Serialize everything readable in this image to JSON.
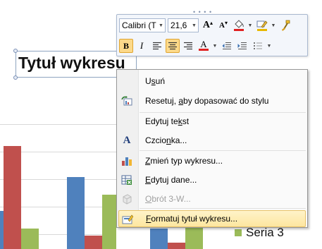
{
  "chart": {
    "title": "Tytuł wykresu",
    "legend": [
      {
        "name": "Seria 3",
        "color": "#9bbb59"
      }
    ],
    "colors": {
      "seria1": "#4f81bd",
      "seria2": "#c0504d",
      "seria3": "#9bbb59"
    }
  },
  "mini_toolbar": {
    "font_name": "Calibri (T",
    "font_size": "21,6",
    "grow_font": "A",
    "shrink_font": "A",
    "bold": "B",
    "italic": "I",
    "font_color_letter": "A",
    "font_color": "#e02020",
    "fill_color": "#e02020",
    "line_color": "#e8b800"
  },
  "context_menu": {
    "items": [
      {
        "pre": "U",
        "ul": "s",
        "post": "uń",
        "icon": "none",
        "enabled": true
      },
      {
        "pre": "Resetuj, ",
        "ul": "a",
        "post": "by dopasować do stylu",
        "icon": "reset-style-icon",
        "enabled": true
      },
      {
        "pre": "Edytuj te",
        "ul": "k",
        "post": "st",
        "icon": "none",
        "enabled": true
      },
      {
        "pre": "Czcio",
        "ul": "n",
        "post": "ka...",
        "icon": "font-icon",
        "enabled": true
      },
      {
        "pre": "",
        "ul": "Z",
        "post": "mień typ wykresu...",
        "icon": "chart-type-icon",
        "enabled": true
      },
      {
        "pre": "",
        "ul": "E",
        "post": "dytuj dane...",
        "icon": "edit-data-icon",
        "enabled": true
      },
      {
        "pre": "",
        "ul": "O",
        "post": "brót 3-W...",
        "icon": "rotate-3d-icon",
        "enabled": false
      },
      {
        "pre": "",
        "ul": "F",
        "post": "ormatuj tytuł wykresu...",
        "icon": "format-title-icon",
        "enabled": true,
        "highlighted": true
      }
    ]
  }
}
